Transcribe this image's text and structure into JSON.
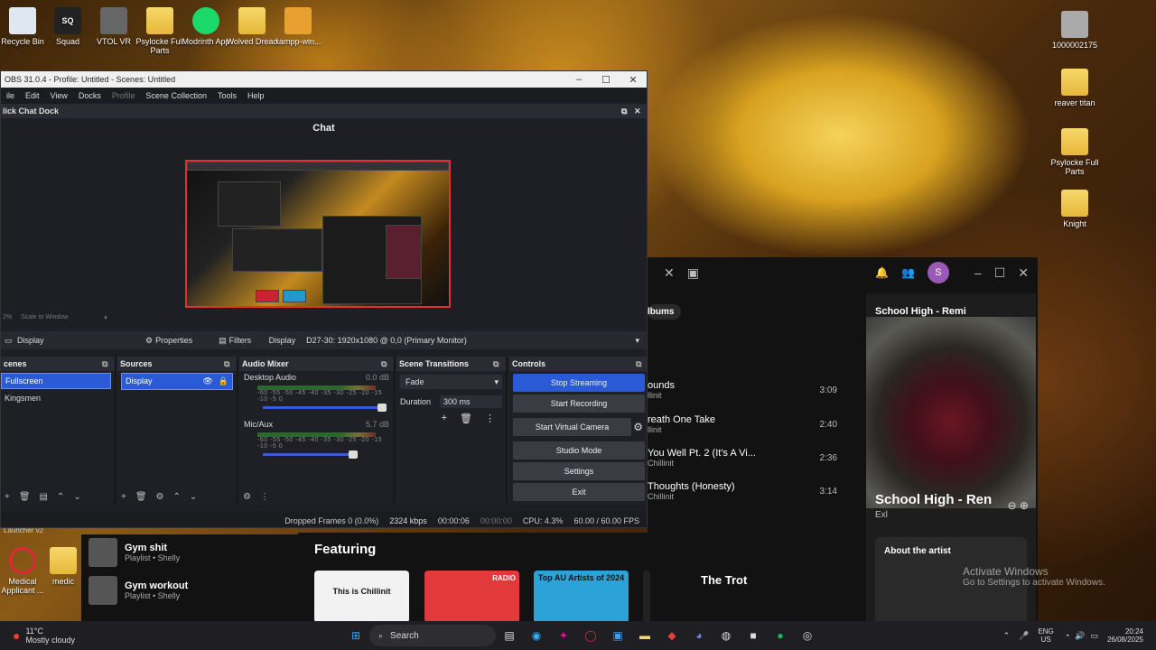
{
  "desktop": {
    "icons": [
      {
        "label": "Recycle Bin"
      },
      {
        "label": "Squad"
      },
      {
        "label": "VTOL VR"
      },
      {
        "label": "Psylocke Full Parts"
      },
      {
        "label": "Modrinth App"
      },
      {
        "label": "Wolved Dread"
      },
      {
        "label": "xampp-win..."
      }
    ],
    "right_icons": [
      {
        "label": "1000002175"
      },
      {
        "label": "reaver titan"
      },
      {
        "label": "Psylocke Full Parts"
      },
      {
        "label": "Knight"
      }
    ],
    "left_bottom": [
      {
        "label": "Medical Applicant ..."
      },
      {
        "label": "medic"
      }
    ],
    "launcher_label": "Launcher v2"
  },
  "obs": {
    "title": "OBS 31.0.4 - Profile: Untitled - Scenes: Untitled",
    "menu": [
      "ile",
      "Edit",
      "View",
      "Docks",
      "Profile",
      "Scene Collection",
      "Tools",
      "Help"
    ],
    "dock_title": "lick Chat Dock",
    "chat_title": "Chat",
    "scale_label": "Scale to Window",
    "zoom": "2%",
    "source_bar": {
      "source": "Display",
      "properties": "Properties",
      "filters": "Filters",
      "display_label": "Display",
      "display_value": "D27-30: 1920x1080 @ 0,0 (Primary Monitor)"
    },
    "scenes": {
      "title": "cenes",
      "items": [
        "Fullscreen",
        "Kingsmen"
      ]
    },
    "sources": {
      "title": "Sources",
      "items": [
        "Display"
      ]
    },
    "mixer": {
      "title": "Audio Mixer",
      "channels": [
        {
          "name": "Desktop Audio",
          "db": "0.0 dB"
        },
        {
          "name": "Mic/Aux",
          "db": "5.7 dB"
        }
      ],
      "scale": "-60 -55 -50 -45 -40 -35 -30 -25 -20 -15 -10 -5 0"
    },
    "transitions": {
      "title": "Scene Transitions",
      "type": "Fade",
      "duration_label": "Duration",
      "duration": "300 ms"
    },
    "controls": {
      "title": "Controls",
      "buttons": [
        "Stop Streaming",
        "Start Recording",
        "Start Virtual Camera",
        "Studio Mode",
        "Settings",
        "Exit"
      ]
    },
    "status": {
      "dropped": "Dropped Frames 0 (0.0%)",
      "bitrate": "2324 kbps",
      "stream_time": "00:00:06",
      "rec_time": "00:00:00",
      "cpu": "CPU: 4.3%",
      "fps": "60.00 / 60.00 FPS"
    }
  },
  "spotify": {
    "albums_label": "lbums",
    "tracks": [
      {
        "title": "ounds",
        "artist": "llinit",
        "duration": "3:09"
      },
      {
        "title": "reath One Take",
        "artist": "llinit",
        "duration": "2:40"
      },
      {
        "title": "You Well Pt. 2 (It's A Vi...",
        "artist": "Chillinit",
        "duration": "2:36"
      },
      {
        "title": "Thoughts (Honesty)",
        "artist": "Chillinit",
        "duration": "3:14"
      }
    ],
    "now_playing": {
      "header": "School High - Remi",
      "title": "School High - Ren",
      "artist": "Exl",
      "about": "About the artist"
    },
    "featuring": {
      "title": "Featuring",
      "cards": [
        "This is Chillinit",
        "RADIO",
        "Top AU Artists of 2024",
        "The Trot"
      ]
    },
    "playlists": [
      {
        "name": "Gym shit",
        "sub": "Playlist • Shelly"
      },
      {
        "name": "Gym workout",
        "sub": "Playlist • Shelly"
      }
    ],
    "avatar_letter": "S"
  },
  "watermark": {
    "title": "Activate Windows",
    "sub": "Go to Settings to activate Windows."
  },
  "taskbar": {
    "weather_temp": "11°C",
    "weather_desc": "Mostly cloudy",
    "search": "Search",
    "lang1": "ENG",
    "lang2": "US",
    "time": "20:24",
    "date": "26/08/2025"
  }
}
